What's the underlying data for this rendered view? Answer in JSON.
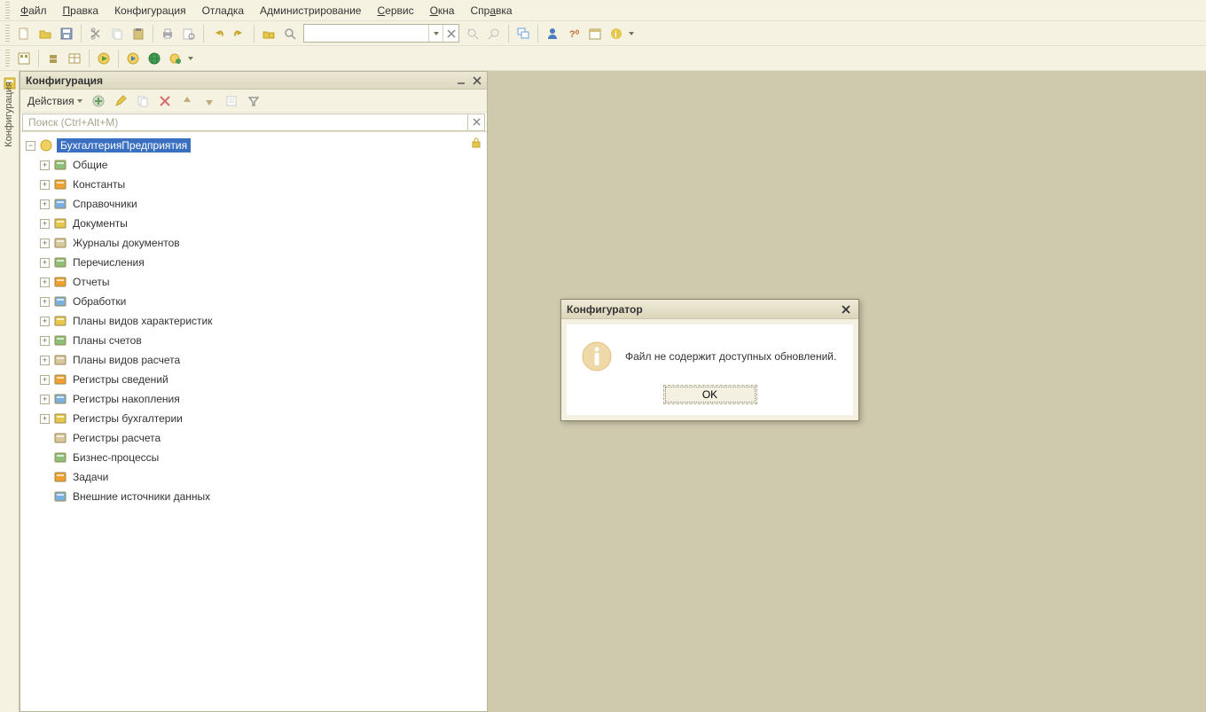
{
  "menu": {
    "file": "Файл",
    "edit": "Правка",
    "config": "Конфигурация",
    "debug": "Отладка",
    "admin": "Администрирование",
    "service": "Сервис",
    "windows": "Окна",
    "help": "Справка"
  },
  "toolbar1": {
    "search_value": "",
    "search_placeholder": ""
  },
  "side_tab": {
    "label": "Конфигурация"
  },
  "panel": {
    "title": "Конфигурация",
    "actions_label": "Действия",
    "search_placeholder": "Поиск (Ctrl+Alt+M)"
  },
  "tree": {
    "root": "БухгалтерияПредприятия",
    "items": [
      {
        "label": "Общие",
        "expandable": true
      },
      {
        "label": "Константы",
        "expandable": true
      },
      {
        "label": "Справочники",
        "expandable": true
      },
      {
        "label": "Документы",
        "expandable": true
      },
      {
        "label": "Журналы документов",
        "expandable": true
      },
      {
        "label": "Перечисления",
        "expandable": true
      },
      {
        "label": "Отчеты",
        "expandable": true
      },
      {
        "label": "Обработки",
        "expandable": true
      },
      {
        "label": "Планы видов характеристик",
        "expandable": true
      },
      {
        "label": "Планы счетов",
        "expandable": true
      },
      {
        "label": "Планы видов расчета",
        "expandable": true
      },
      {
        "label": "Регистры сведений",
        "expandable": true
      },
      {
        "label": "Регистры накопления",
        "expandable": true
      },
      {
        "label": "Регистры бухгалтерии",
        "expandable": true
      },
      {
        "label": "Регистры расчета",
        "expandable": false
      },
      {
        "label": "Бизнес-процессы",
        "expandable": false
      },
      {
        "label": "Задачи",
        "expandable": false
      },
      {
        "label": "Внешние источники данных",
        "expandable": false
      }
    ]
  },
  "dialog": {
    "title": "Конфигуратор",
    "message": "Файл не содержит доступных обновлений.",
    "ok": "OK"
  },
  "icons": {
    "tree_colors": [
      "#8cc079",
      "#f0a030",
      "#7ab0e0",
      "#e6c74d",
      "#d6c89c",
      "#8cc079",
      "#f0a030",
      "#7ab0e0",
      "#e6c74d",
      "#8cc079",
      "#d6c89c",
      "#f0a030",
      "#7ab0e0",
      "#e6c74d",
      "#d6c89c",
      "#8cc079",
      "#f0a030",
      "#7ab0e0"
    ]
  }
}
